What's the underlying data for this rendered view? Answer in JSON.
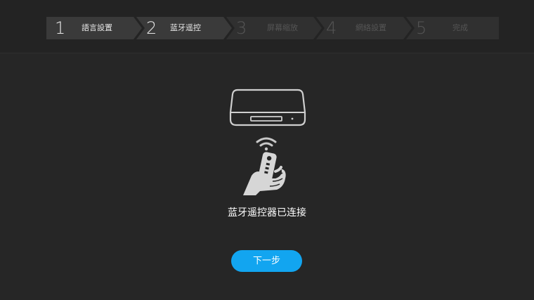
{
  "steps": [
    {
      "num": "1",
      "label": "語言設置",
      "state": "done"
    },
    {
      "num": "2",
      "label": "蓝牙遥控",
      "state": "done"
    },
    {
      "num": "3",
      "label": "屏幕缩放",
      "state": "pending"
    },
    {
      "num": "4",
      "label": "網絡設置",
      "state": "pending"
    },
    {
      "num": "5",
      "label": "完成",
      "state": "pending"
    }
  ],
  "icons": [
    "set-top-box-icon",
    "wifi-signal-icon",
    "hand-remote-icon"
  ],
  "message": "蓝牙遥控器已连接",
  "next_button": "下一步",
  "colors": {
    "background": "#262626",
    "accent": "#12a5f0",
    "step_done_bg": "#3a3a3a",
    "step_pending_bg": "#303030"
  }
}
